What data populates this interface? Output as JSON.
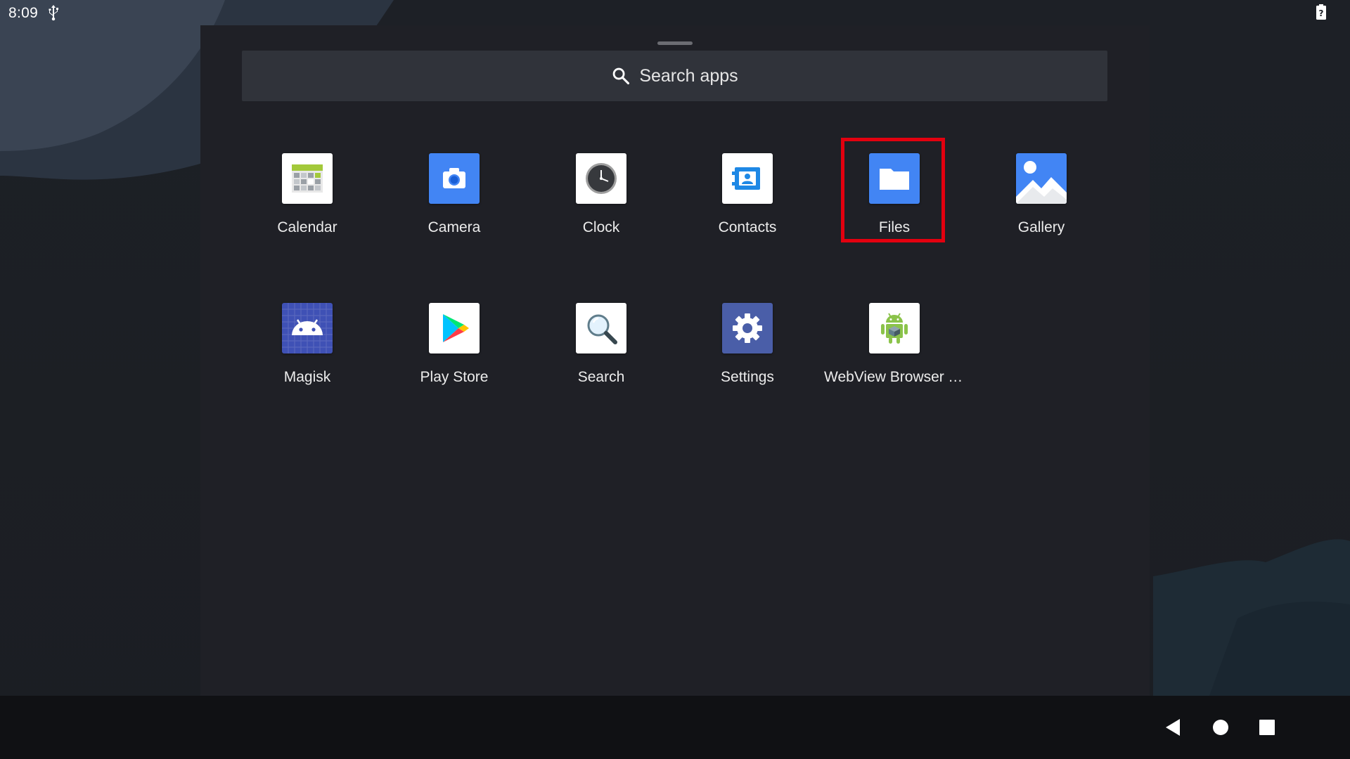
{
  "status_bar": {
    "time": "8:09",
    "icons": [
      "usb-icon",
      "battery-unknown-icon"
    ]
  },
  "search": {
    "label": "Search apps",
    "icon": "search-icon"
  },
  "apps": [
    {
      "id": "calendar",
      "label": "Calendar",
      "icon": "calendar-icon"
    },
    {
      "id": "camera",
      "label": "Camera",
      "icon": "camera-icon"
    },
    {
      "id": "clock",
      "label": "Clock",
      "icon": "clock-icon"
    },
    {
      "id": "contacts",
      "label": "Contacts",
      "icon": "contacts-icon"
    },
    {
      "id": "files",
      "label": "Files",
      "icon": "folder-icon"
    },
    {
      "id": "gallery",
      "label": "Gallery",
      "icon": "gallery-icon"
    },
    {
      "id": "magisk",
      "label": "Magisk",
      "icon": "android-head-icon"
    },
    {
      "id": "play-store",
      "label": "Play Store",
      "icon": "play-store-icon"
    },
    {
      "id": "search",
      "label": "Search",
      "icon": "magnifier-icon"
    },
    {
      "id": "settings",
      "label": "Settings",
      "icon": "gear-icon"
    },
    {
      "id": "webview",
      "label": "WebView Browser T...",
      "icon": "android-robot-icon"
    }
  ],
  "navigation": {
    "buttons": [
      "back-icon",
      "home-icon",
      "recents-icon"
    ]
  },
  "colors": {
    "highlight": "#e3000f",
    "drawer_bg": "#1f2026",
    "search_bg": "#30333a",
    "navbar_bg": "#101114"
  }
}
